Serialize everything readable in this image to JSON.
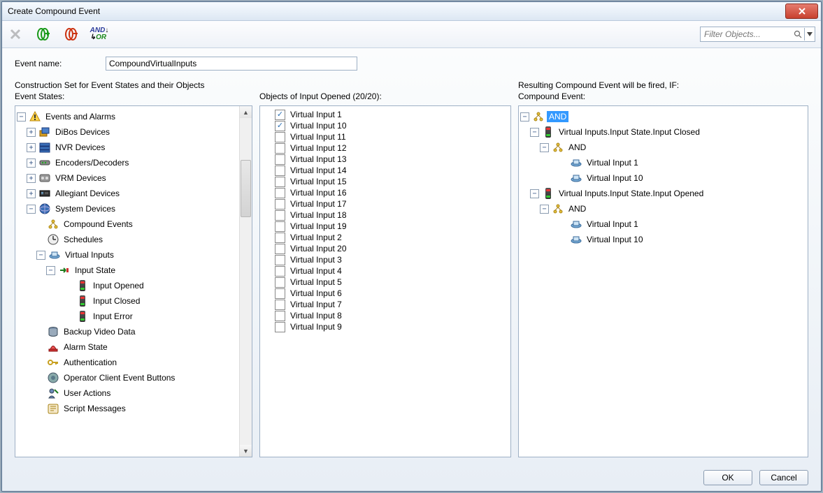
{
  "window": {
    "title": "Create Compound Event",
    "close": "×"
  },
  "toolbar": {
    "delete": "✕",
    "andor_and": "AND",
    "andor_or": "OR",
    "filter_placeholder": "Filter Objects..."
  },
  "form": {
    "event_name_label": "Event name:",
    "event_name_value": "CompoundVirtualInputs",
    "construction_title": "Construction Set for Event States and their Objects",
    "resulting_title": "Resulting Compound Event will be fired, IF:"
  },
  "cols": {
    "states_label": "Event States:",
    "objects_label": "Objects of Input Opened (20/20):",
    "compound_label": "Compound Event:"
  },
  "tree": {
    "root": "Events and Alarms",
    "dibos": "DiBos Devices",
    "nvr": "NVR Devices",
    "encoders": "Encoders/Decoders",
    "vrm": "VRM Devices",
    "allegiant": "Allegiant Devices",
    "system": "System Devices",
    "compound_events": "Compound Events",
    "schedules": "Schedules",
    "virtual_inputs": "Virtual Inputs",
    "input_state": "Input State",
    "input_opened": "Input Opened",
    "input_closed": "Input Closed",
    "input_error": "Input Error",
    "backup": "Backup Video Data",
    "alarm_state": "Alarm State",
    "auth": "Authentication",
    "op_buttons": "Operator Client Event Buttons",
    "user_actions": "User Actions",
    "script": "Script Messages"
  },
  "objects": [
    {
      "label": "Virtual Input 1",
      "checked": true
    },
    {
      "label": "Virtual Input 10",
      "checked": true
    },
    {
      "label": "Virtual Input 11",
      "checked": false
    },
    {
      "label": "Virtual Input 12",
      "checked": false
    },
    {
      "label": "Virtual Input 13",
      "checked": false
    },
    {
      "label": "Virtual Input 14",
      "checked": false
    },
    {
      "label": "Virtual Input 15",
      "checked": false
    },
    {
      "label": "Virtual Input 16",
      "checked": false
    },
    {
      "label": "Virtual Input 17",
      "checked": false
    },
    {
      "label": "Virtual Input 18",
      "checked": false
    },
    {
      "label": "Virtual Input 19",
      "checked": false
    },
    {
      "label": "Virtual Input 2",
      "checked": false
    },
    {
      "label": "Virtual Input 20",
      "checked": false
    },
    {
      "label": "Virtual Input 3",
      "checked": false
    },
    {
      "label": "Virtual Input 4",
      "checked": false
    },
    {
      "label": "Virtual Input 5",
      "checked": false
    },
    {
      "label": "Virtual Input 6",
      "checked": false
    },
    {
      "label": "Virtual Input 7",
      "checked": false
    },
    {
      "label": "Virtual Input 8",
      "checked": false
    },
    {
      "label": "Virtual Input 9",
      "checked": false
    }
  ],
  "result": {
    "and_root": "AND",
    "closed": "Virtual Inputs.Input State.Input Closed",
    "and1": "AND",
    "vi1": "Virtual Input 1",
    "vi10": "Virtual Input 10",
    "opened": "Virtual Inputs.Input State.Input Opened",
    "and2": "AND",
    "vi1b": "Virtual Input 1",
    "vi10b": "Virtual Input 10"
  },
  "footer": {
    "ok": "OK",
    "cancel": "Cancel"
  }
}
